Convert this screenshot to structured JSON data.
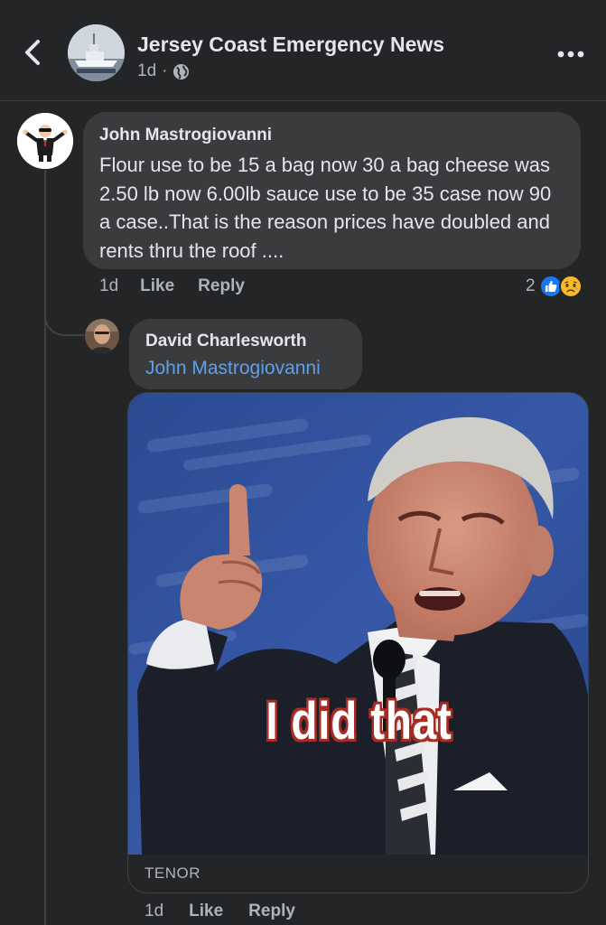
{
  "header": {
    "page_name": "Jersey Coast Emergency News",
    "time": "1d",
    "separator": "·"
  },
  "comments": [
    {
      "author": "John Mastrogiovanni",
      "text": "Flour use to be 15 a bag now 30 a bag cheese was 2.50 lb now 6.00lb sauce use to be 35 case now 90 a case..That is the reason prices have doubled and rents thru the roof ....",
      "time": "1d",
      "like_label": "Like",
      "reply_label": "Reply",
      "reaction_count": "2",
      "reactions": [
        "like",
        "sad"
      ]
    },
    {
      "author": "David Charlesworth",
      "mention": "John Mastrogiovanni",
      "gif_caption": "I did that",
      "gif_source": "TENOR",
      "time": "1d",
      "like_label": "Like",
      "reply_label": "Reply"
    }
  ],
  "colors": {
    "background": "#242526",
    "bubble": "#3a3b3c",
    "text": "#e4e6eb",
    "secondary_text": "#b0b3b8",
    "mention": "#5ea0ee",
    "like_blue": "#1877f2",
    "sad_yellow": "#f7b928"
  }
}
